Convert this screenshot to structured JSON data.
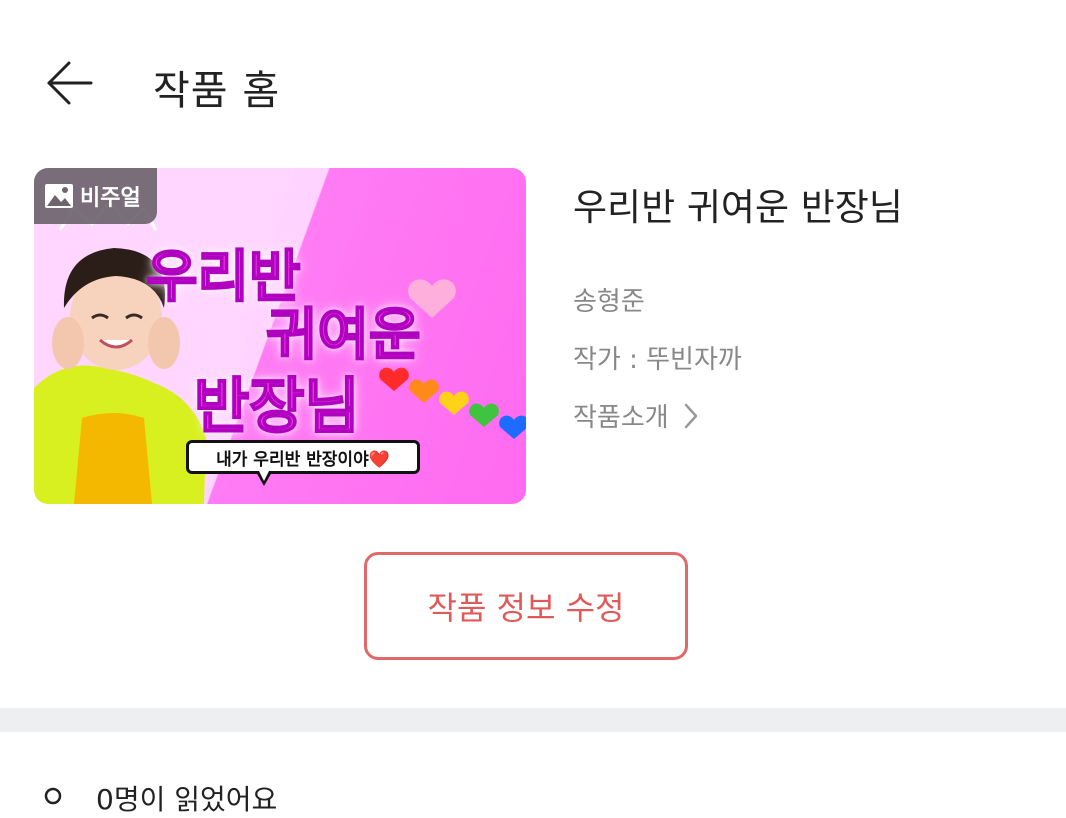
{
  "header": {
    "title": "작품 홈"
  },
  "cover": {
    "badge": "비주얼",
    "title_lines": [
      "우리반",
      "귀여운",
      "반장님"
    ],
    "speech": "내가 우리반 반장이야❤️"
  },
  "work": {
    "title": "우리반 귀여운 반장님",
    "author_name": "송형준",
    "writer_line": "작가 : 뚜빈자까",
    "intro_label": "작품소개"
  },
  "actions": {
    "edit_label": "작품 정보 수정"
  },
  "stats": {
    "readers_text": "0명이 읽었어요"
  },
  "colors": {
    "edit_accent": "#e05a5a",
    "cover_pink": "#ff7cf4",
    "divider": "#eeeff1"
  },
  "icons": {
    "back": "arrow-left-icon",
    "badge": "image-icon",
    "intro": "chevron-right-icon",
    "readers": "person-icon"
  }
}
